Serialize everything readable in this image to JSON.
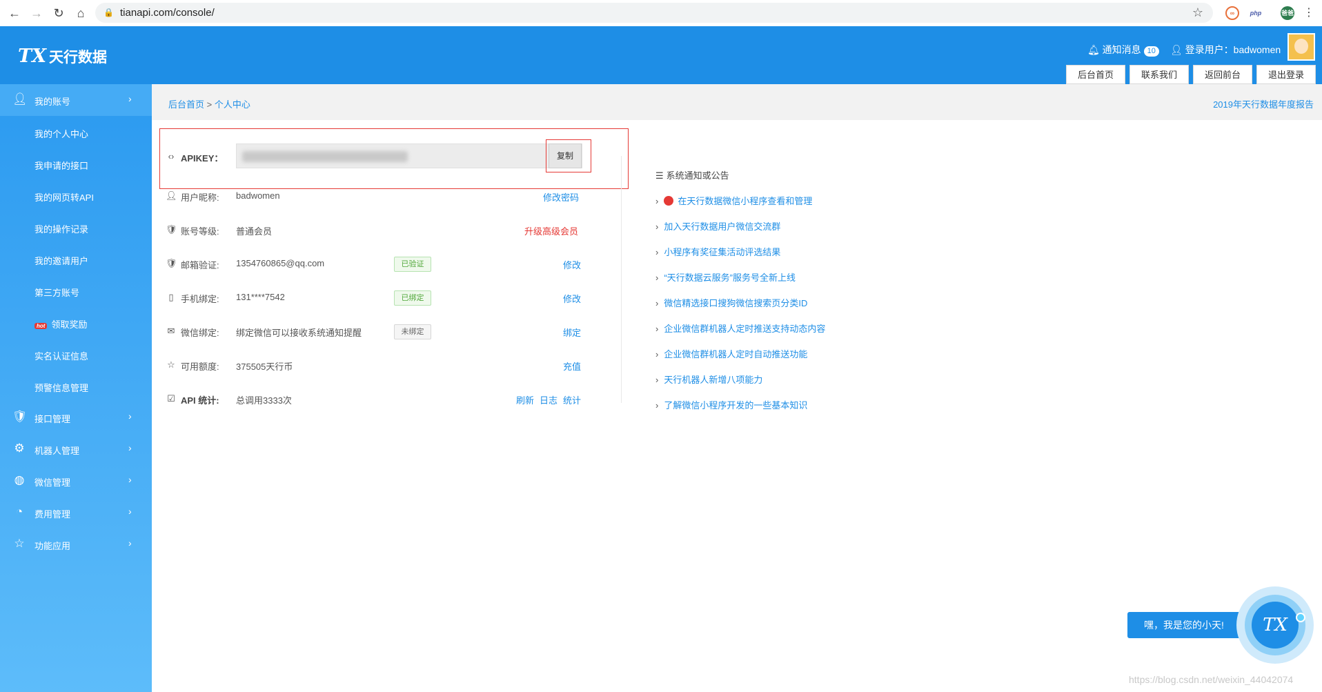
{
  "browser": {
    "url": "tianapi.com/console/",
    "ext_php": "php",
    "ext_profile": "爸爸"
  },
  "header": {
    "logo_mark": "TX",
    "logo_text": "天行数据",
    "notify_label": "通知消息",
    "notify_count": "10",
    "login_label": "登录用户：badwomen",
    "buttons": [
      "后台首页",
      "联系我们",
      "返回前台",
      "退出登录"
    ]
  },
  "sidebar": {
    "account": "我的账号",
    "sub_items": [
      "我的个人中心",
      "我申请的接口",
      "我的网页转API",
      "我的操作记录",
      "我的邀请用户",
      "第三方账号",
      "领取奖励",
      "实名认证信息",
      "预警信息管理"
    ],
    "hot_tag": "hot",
    "groups": [
      "接口管理",
      "机器人管理",
      "微信管理",
      "费用管理",
      "功能应用"
    ]
  },
  "breadcrumb": {
    "home": "后台首页",
    "sep": " > ",
    "current": "个人中心",
    "report": "2019年天行数据年度报告"
  },
  "profile": {
    "apikey_label": "APIKEY：",
    "copy_label": "复制",
    "nickname_label": "用户昵称:",
    "nickname_value": "badwomen",
    "nickname_action": "修改密码",
    "level_label": "账号等级:",
    "level_value": "普通会员",
    "level_action": "升级高级会员",
    "email_label": "邮箱验证:",
    "email_value": "1354760865@qq.com",
    "email_tag": "已验证",
    "email_action": "修改",
    "phone_label": "手机绑定:",
    "phone_value": "131****7542",
    "phone_tag": "已绑定",
    "phone_action": "修改",
    "wechat_label": "微信绑定:",
    "wechat_value": "绑定微信可以接收系统通知提醒",
    "wechat_tag": "未绑定",
    "wechat_action": "绑定",
    "quota_label": "可用额度:",
    "quota_value": "375505天行币",
    "quota_action": "充值",
    "api_label": "API 统计:",
    "api_value": "总调用3333次",
    "api_actions": [
      "刷新",
      "日志",
      "统计"
    ]
  },
  "notices": {
    "title": "系统通知或公告",
    "items": [
      "在天行数据微信小程序查看和管理",
      "加入天行数据用户微信交流群",
      "小程序有奖征集活动评选结果",
      "“天行数据云服务”服务号全新上线",
      "微信精选接口搜狗微信搜索页分类ID",
      "企业微信群机器人定时推送支持动态内容",
      "企业微信群机器人定时自动推送功能",
      "天行机器人新增八项能力",
      "了解微信小程序开发的一些基本知识"
    ]
  },
  "chat": {
    "bubble": "嘿，我是您的小天!",
    "orb_text": "TX"
  },
  "watermark": "https://blog.csdn.net/weixin_44042074",
  "colors": {
    "primary": "#1e8ee6",
    "danger": "#e53935",
    "success": "#52a83b"
  }
}
